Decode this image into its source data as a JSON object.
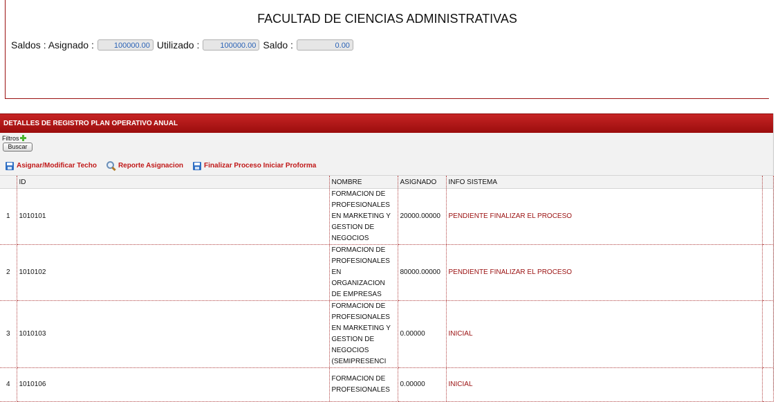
{
  "header": {
    "title": "FACULTAD DE CIENCIAS ADMINISTRATIVAS",
    "saldos_label": "Saldos : Asignado :",
    "asignado_value": "100000.00",
    "utilizado_label": "Utilizado :",
    "utilizado_value": "100000.00",
    "saldo_label": "Saldo :",
    "saldo_value": "0.00"
  },
  "grid": {
    "title": "DETALLES DE REGISTRO PLAN OPERATIVO ANUAL",
    "filtros_label": "Filtros",
    "buscar_label": "Buscar",
    "actions": {
      "asignar": "Asignar/Modificar Techo",
      "reporte": "Reporte Asignacion",
      "finalizar": "Finalizar Proceso Iniciar Proforma"
    },
    "columns": {
      "id": "ID",
      "nombre": "NOMBRE",
      "asignado": "ASIGNADO",
      "info": "INFO SISTEMA"
    },
    "rows": [
      {
        "num": "1",
        "id": "1010101",
        "nombre": "FORMACION DE PROFESIONALES EN MARKETING Y GESTION DE NEGOCIOS",
        "asignado": "20000.00000",
        "info": "PENDIENTE FINALIZAR EL PROCESO"
      },
      {
        "num": "2",
        "id": "1010102",
        "nombre": "FORMACION DE PROFESIONALES EN ORGANIZACION DE EMPRESAS",
        "asignado": "80000.00000",
        "info": "PENDIENTE FINALIZAR EL PROCESO"
      },
      {
        "num": "3",
        "id": "1010103",
        "nombre": "FORMACION DE PROFESIONALES EN MARKETING Y GESTION DE NEGOCIOS (SEMIPRESENCI",
        "asignado": "0.00000",
        "info": "INICIAL"
      },
      {
        "num": "4",
        "id": "1010106",
        "nombre": "FORMACION DE PROFESIONALES",
        "asignado": "0.00000",
        "info": "INICIAL"
      }
    ]
  },
  "colors": {
    "accent": "#9b0d0d",
    "info_text": "#9a1010",
    "action_text": "#c01818",
    "field_text": "#2a62b6"
  }
}
